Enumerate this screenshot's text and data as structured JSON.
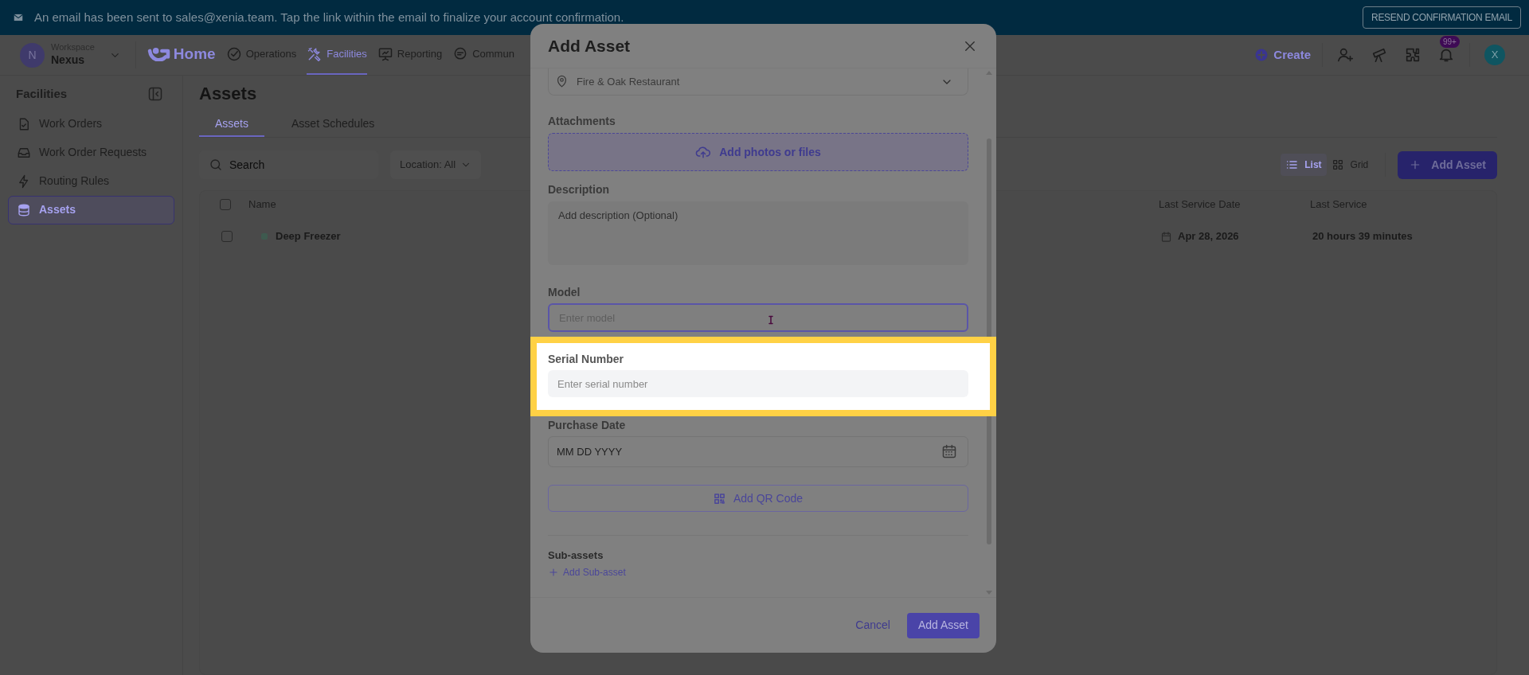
{
  "banner": {
    "message": "An email has been sent to sales@xenia.team. Tap the link within the email to finalize your account confirmation.",
    "button": "RESEND CONFIRMATION EMAIL"
  },
  "workspace": {
    "initial": "N",
    "label": "Workspace",
    "name": "Nexus"
  },
  "nav": [
    {
      "kind": "brand",
      "label": "Home",
      "selected": false
    },
    {
      "kind": "item",
      "label": "Operations",
      "selected": false
    },
    {
      "kind": "item",
      "label": "Facilities",
      "selected": true
    },
    {
      "kind": "item",
      "label": "Reporting",
      "selected": false
    },
    {
      "kind": "item",
      "label": "Commun",
      "selected": false
    }
  ],
  "header_actions": {
    "create": "Create",
    "notifications_badge": "99+",
    "avatar_initial": "X"
  },
  "sidebar": {
    "title": "Facilities",
    "items": [
      {
        "label": "Work Orders",
        "selected": false
      },
      {
        "label": "Work Order Requests",
        "selected": false
      },
      {
        "label": "Routing Rules",
        "selected": false
      },
      {
        "label": "Assets",
        "selected": true
      }
    ]
  },
  "page": {
    "title": "Assets",
    "tabs": [
      {
        "label": "Assets",
        "selected": true
      },
      {
        "label": "Asset Schedules",
        "selected": false
      }
    ],
    "search_placeholder": "Search",
    "location_filter": "Location: All",
    "views": [
      {
        "label": "List",
        "selected": true
      },
      {
        "label": "Grid",
        "selected": false
      }
    ],
    "add_button": "Add Asset"
  },
  "table": {
    "select_all_checked": false,
    "columns": [
      "Name",
      "Last Service Date",
      "Last Service"
    ],
    "rows": [
      {
        "checked": false,
        "color": "#3e5a4f",
        "name": "Deep Freezer",
        "last_service_date": "Apr 28, 2026",
        "last_service": "20 hours 39 minutes"
      }
    ]
  },
  "modal": {
    "title": "Add Asset",
    "location": "Fire & Oak Restaurant",
    "attachments": {
      "label": "Attachments",
      "action": "Add photos or files"
    },
    "description": {
      "label": "Description",
      "placeholder": "Add description (Optional)"
    },
    "model": {
      "label": "Model",
      "placeholder": "Enter model",
      "focused": true
    },
    "serial_number": {
      "label": "Serial Number",
      "placeholder": "Enter serial number",
      "highlighted": true
    },
    "purchase_date": {
      "label": "Purchase Date",
      "placeholder": "MM DD YYYY"
    },
    "qr_button": "Add QR Code",
    "sub_assets": {
      "label": "Sub-assets",
      "action": "Add Sub-asset"
    },
    "cancel": "Cancel",
    "submit": "Add Asset"
  }
}
